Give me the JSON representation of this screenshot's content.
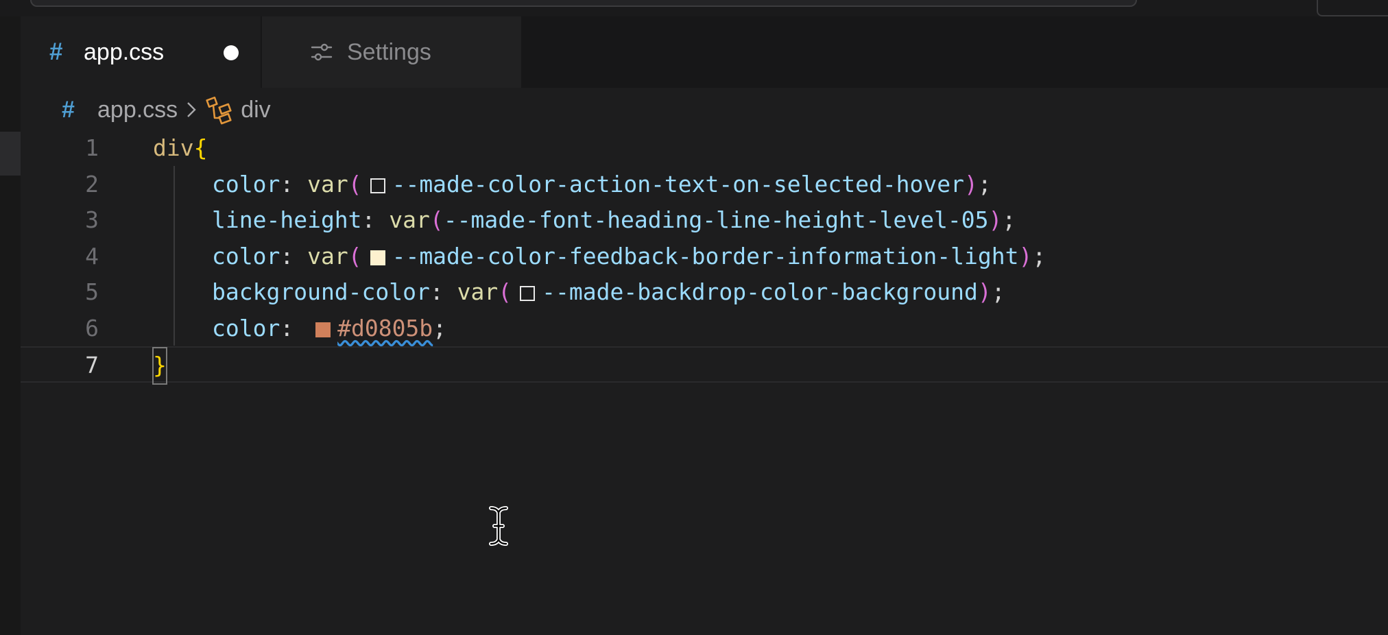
{
  "tabs": [
    {
      "icon": "hash-icon",
      "label": "app.css",
      "dirty": true
    },
    {
      "icon": "settings-sliders-icon",
      "label": "Settings"
    }
  ],
  "breadcrumb": {
    "file": "app.css",
    "symbol": "div"
  },
  "editor": {
    "current_line": 7,
    "lines": [
      {
        "number": "1",
        "selector": "div",
        "brace": "{"
      },
      {
        "number": "2",
        "property": "color",
        "fn": "var",
        "swatch": "#1d1d1e",
        "variable": "--made-color-action-text-on-selected-hover"
      },
      {
        "number": "3",
        "property": "line-height",
        "fn": "var",
        "variable": "--made-font-heading-line-height-level-05"
      },
      {
        "number": "4",
        "property": "color",
        "fn": "var",
        "swatch": "#fdf1cf",
        "variable": "--made-color-feedback-border-information-light"
      },
      {
        "number": "5",
        "property": "background-color",
        "fn": "var",
        "swatch": "#1d1d1e",
        "variable": "--made-backdrop-color-background"
      },
      {
        "number": "6",
        "property": "color",
        "swatch": "#d0805b",
        "value": "#d0805b"
      },
      {
        "number": "7",
        "brace": "}"
      }
    ]
  },
  "colors": {
    "background": "#1d1d1e",
    "accent_hash": "#4f9fd4",
    "selector": "#d7ba7d",
    "property": "#9cdcfe",
    "function": "#dcdcaa",
    "paren": "#da70d6",
    "brace": "#ffd700"
  }
}
